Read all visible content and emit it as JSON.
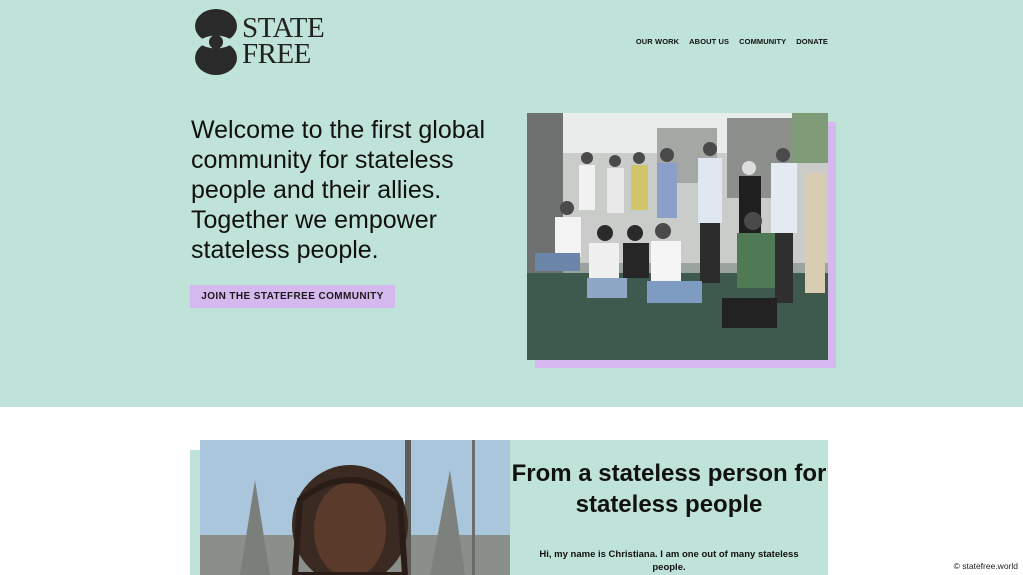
{
  "logo": {
    "line1": "STATE",
    "line2": "FREE"
  },
  "nav": {
    "items": [
      "OUR WORK",
      "ABOUT US",
      "COMMUNITY",
      "DONATE"
    ]
  },
  "hero": {
    "headline": "Welcome to the first global community for stateless people and their allies. Together we empower stateless people.",
    "cta_label": "JOIN THE STATEFREE COMMUNITY"
  },
  "story": {
    "title": "From a stateless person for stateless people",
    "body": "Hi, my name is Christiana. I am one out of many stateless people."
  },
  "credit": "© statefree.world",
  "colors": {
    "mint": "#bfe3d8",
    "lavender": "#d5b8ed",
    "text": "#111111"
  }
}
